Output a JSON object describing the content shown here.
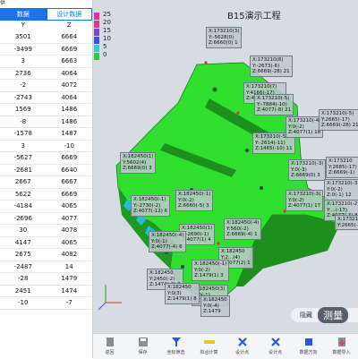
{
  "breadcrumb": "供",
  "tabs": [
    {
      "label": "数据",
      "active": true
    },
    {
      "label": "设计数据",
      "active": false
    }
  ],
  "columns": [
    "Y",
    "Z"
  ],
  "rows": [
    [
      "3501",
      "6664"
    ],
    [
      "-3499",
      "6669"
    ],
    [
      "3",
      "6663"
    ],
    [
      "2736",
      "4064"
    ],
    [
      "-2",
      "4072"
    ],
    [
      "-2743",
      "4064"
    ],
    [
      "1569",
      "1486"
    ],
    [
      "-8",
      "1486"
    ],
    [
      "-1578",
      "1487"
    ],
    [
      "3",
      "-10"
    ],
    [
      "-5627",
      "6669"
    ],
    [
      "-2681",
      "6640"
    ],
    [
      "2667",
      "6667"
    ],
    [
      "5622",
      "6669"
    ],
    [
      "-4184",
      "4065"
    ],
    [
      "-2696",
      "4077"
    ],
    [
      "30",
      "4078"
    ],
    [
      "4147",
      "4065"
    ],
    [
      "2675",
      "4082"
    ],
    [
      "-2487",
      "14"
    ],
    [
      "-28",
      "1479"
    ],
    [
      "2451",
      "1474"
    ],
    [
      "-10",
      "-7"
    ]
  ],
  "view_title": "B15演示工程",
  "legend": [
    {
      "label": "25",
      "color": "#e5339a"
    },
    {
      "label": "20",
      "color": "#e5339a"
    },
    {
      "label": "15",
      "color": "#7e3fd6"
    },
    {
      "label": "10",
      "color": "#2f56e0"
    },
    {
      "label": "5",
      "color": "#34c7d8"
    },
    {
      "label": "0",
      "color": "#29d03a"
    }
  ],
  "labels": [
    {
      "text": "X:173210(3)\nY:-5628(0)\nZ:6660(0) 1"
    },
    {
      "text": "X:173210(8)\nY:-2673(-6)\nZ:6669(-28) 21"
    },
    {
      "text": "X:173210(7)\nY:4166(-17)\nZ:4077(-12) 21"
    },
    {
      "text": "X:173210(-5)\nY:-7884(-10)\nZ:4077(-8) 21"
    },
    {
      "text": "X:173210(-5)\nY:-2614(-11)\nZ:1465(-10) 11"
    },
    {
      "text": "X:173210(-4)\nY:0(-2)\nZ:4077(1) 18"
    },
    {
      "text": "X:173210(-5)\nY:2665(-17)\nZ:6669(-28) 21"
    },
    {
      "text": "X:173210(-3)\nY:0(-3)\nZ:6669(0) 3"
    },
    {
      "text": "X:173210\nY:2685(-17)\nZ:6669(-1)"
    },
    {
      "text": "X:173210(-3)\nY:0(-2)\nZ:4077(1) 17"
    },
    {
      "text": "X:173210(-3)\nY:0(-2)\nZ:0(-1) 12"
    },
    {
      "text": "X:173210(-2)\nY:...(-17)\nZ:4077(-3) 8"
    },
    {
      "text": "X:173210\nY:2665(-1)"
    },
    {
      "text": "X:182450(1)\nY:5602(4)\nZ:6669(0) 3"
    },
    {
      "text": "X:182450(-1)\nY:-2730(-2)\nZ:4077(-12) 6"
    },
    {
      "text": "X:182450(-1)\nY:0(-2)\nZ:6660(-5) 3"
    },
    {
      "text": "X:182450(1)\nY:-2690(-1)\nZ:4077(1) 4"
    },
    {
      "text": "X:182450(-4)\nY:560(-2)\nZ:6669(-4) 1"
    },
    {
      "text": "X:182450(-4)\nY:0(-1)\nZ:4077(-4) 6"
    },
    {
      "text": "X:182450\nY:2...(4)\nZ:4077(2) 1"
    },
    {
      "text": "X:182450(-1)\nY:0(-2)\nZ:1479(1) 3"
    },
    {
      "text": "X:182450\nY:2450(-2)\nZ:1474(-3) 2"
    },
    {
      "text": "X:182450(3)\nY:0(-1)\nZ:1489(-1) 8"
    },
    {
      "text": "X:182450\nY:0(3)\nZ:1479(1) 8"
    },
    {
      "text": "X:182450\nY:0(-4)\nZ:1479"
    }
  ],
  "measure": {
    "hide_label": "隐藏",
    "measure_label": "测量"
  },
  "toolbar": [
    {
      "label": "返回",
      "icon": "back-icon"
    },
    {
      "label": "保存",
      "icon": "save-icon"
    },
    {
      "label": "坐标筛选",
      "icon": "filter-icon"
    },
    {
      "label": "拟合计算",
      "icon": "fit-icon"
    },
    {
      "label": "设计点",
      "icon": "delete-icon"
    },
    {
      "label": "设计点",
      "icon": "delete-icon"
    },
    {
      "label": "数据方向",
      "icon": "cube-icon"
    },
    {
      "label": "数据导入",
      "icon": "import-icon"
    }
  ]
}
